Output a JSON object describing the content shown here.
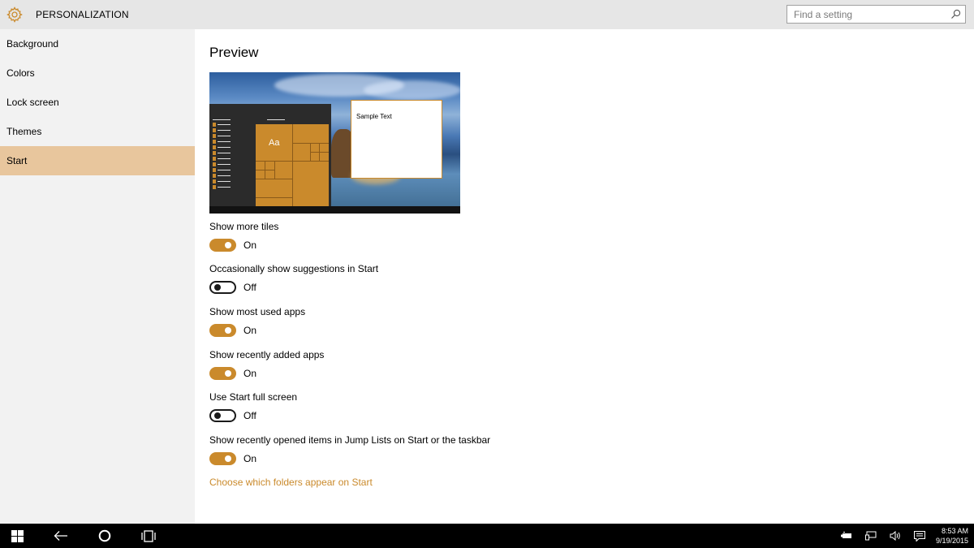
{
  "header": {
    "app_title": "PERSONALIZATION",
    "search_placeholder": "Find a setting",
    "icon": "gear-icon",
    "accent_color": "#ca8a2c"
  },
  "sidebar": {
    "items": [
      {
        "label": "Background",
        "active": false
      },
      {
        "label": "Colors",
        "active": false
      },
      {
        "label": "Lock screen",
        "active": false
      },
      {
        "label": "Themes",
        "active": false
      },
      {
        "label": "Start",
        "active": true
      }
    ],
    "active_color": "#e8c69d"
  },
  "main": {
    "page_title": "Preview",
    "preview": {
      "tile_text": "Aa",
      "sample_text": "Sample Text"
    },
    "settings": [
      {
        "label": "Show more tiles",
        "state": "On",
        "on": true
      },
      {
        "label": "Occasionally show suggestions in Start",
        "state": "Off",
        "on": false
      },
      {
        "label": "Show most used apps",
        "state": "On",
        "on": true
      },
      {
        "label": "Show recently added apps",
        "state": "On",
        "on": true
      },
      {
        "label": "Use Start full screen",
        "state": "Off",
        "on": false
      },
      {
        "label": "Show recently opened items in Jump Lists on Start or the taskbar",
        "state": "On",
        "on": true
      }
    ],
    "link": "Choose which folders appear on Start"
  },
  "taskbar": {
    "left_icons": [
      "windows-start-icon",
      "back-arrow-icon",
      "cortana-circle-icon",
      "task-view-icon"
    ],
    "tray_icons": [
      "battery-icon",
      "network-icon",
      "volume-icon",
      "action-center-icon"
    ],
    "time": "8:53 AM",
    "date": "9/19/2015"
  }
}
